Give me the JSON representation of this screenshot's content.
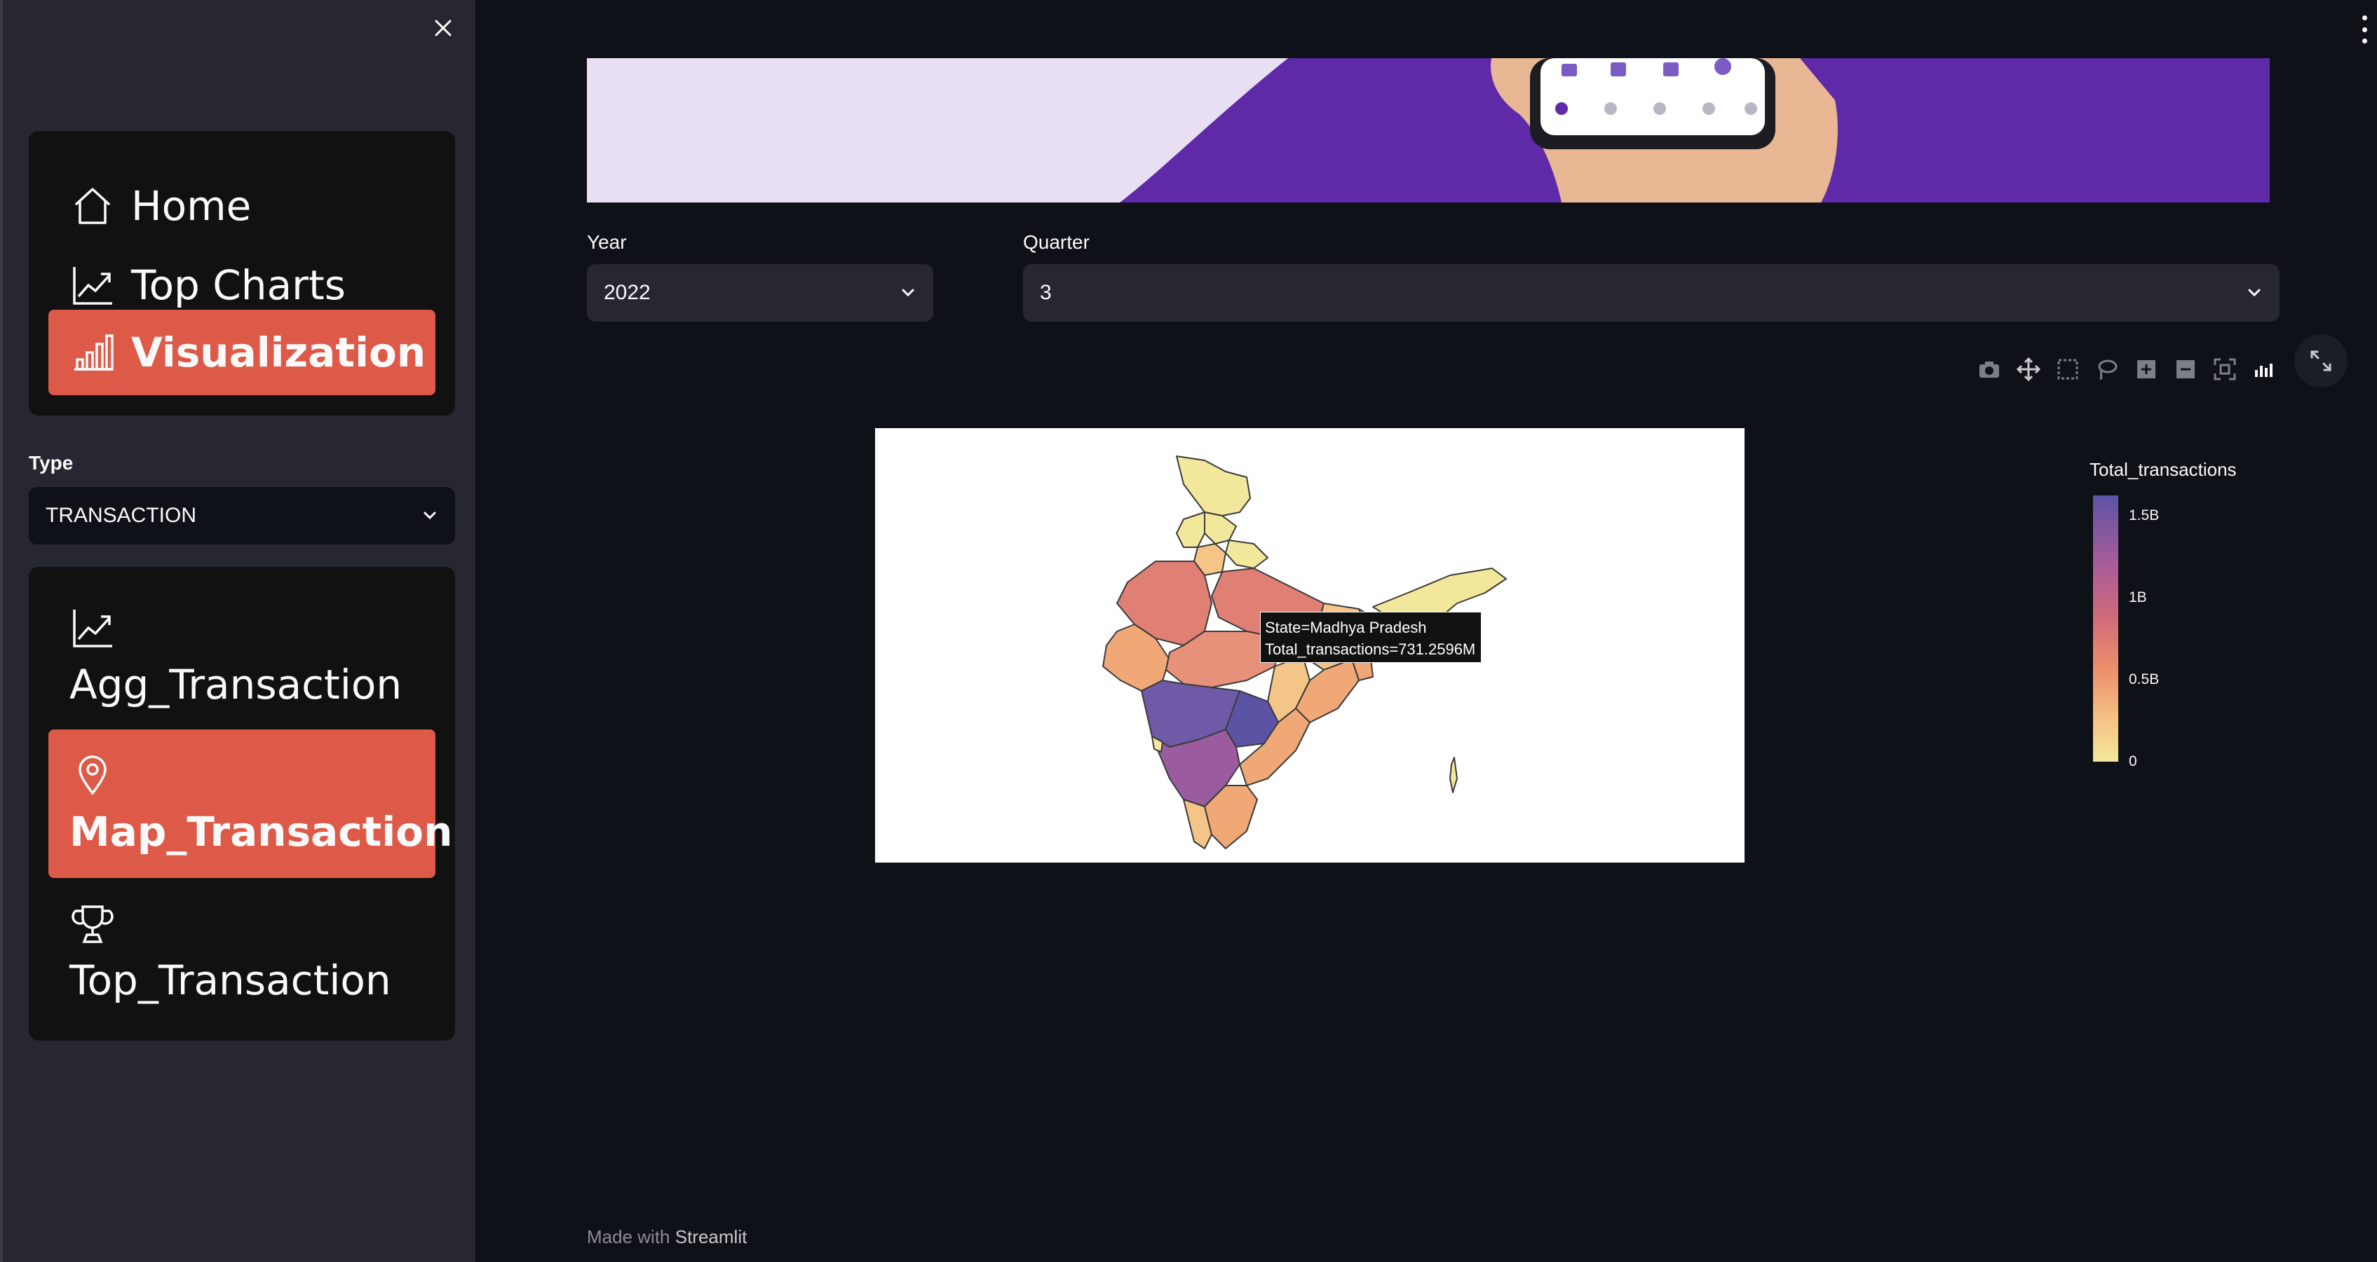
{
  "sidebar": {
    "nav_items": [
      {
        "label": "Home",
        "icon": "house-icon",
        "active": false
      },
      {
        "label": "Top Charts",
        "icon": "graph-up-icon",
        "active": false
      },
      {
        "label": "Visualization",
        "icon": "bar-chart-icon",
        "active": true
      }
    ],
    "type_label": "Type",
    "type_value": "TRANSACTION",
    "sub_items": [
      {
        "label": "Agg_Transaction",
        "icon": "graph-up-icon",
        "active": false
      },
      {
        "label": "Map_Transaction",
        "icon": "map-pin-icon",
        "active": true
      },
      {
        "label": "Top_Transaction",
        "icon": "trophy-icon",
        "active": false
      }
    ]
  },
  "filters": {
    "year_label": "Year",
    "year_value": "2022",
    "quarter_label": "Quarter",
    "quarter_value": "3"
  },
  "map": {
    "tooltip_line1": "State=Madhya Pradesh",
    "tooltip_line2": "Total_transactions=731.2596M",
    "colorbar_title": "Total_transactions",
    "colorbar_ticks": [
      "1.5B",
      "1B",
      "0.5B",
      "0"
    ],
    "colorscale": [
      "#5c53a5",
      "#a65c99",
      "#ce6a7b",
      "#eb8f6b",
      "#f5c587",
      "#f3e79b"
    ]
  },
  "footer": {
    "prefix": "Made with",
    "brand": "Streamlit"
  },
  "colors": {
    "accent": "#dd5a48",
    "banner_purple": "#5e2aa8",
    "background": "#0e1117",
    "sidebar": "#262730"
  }
}
